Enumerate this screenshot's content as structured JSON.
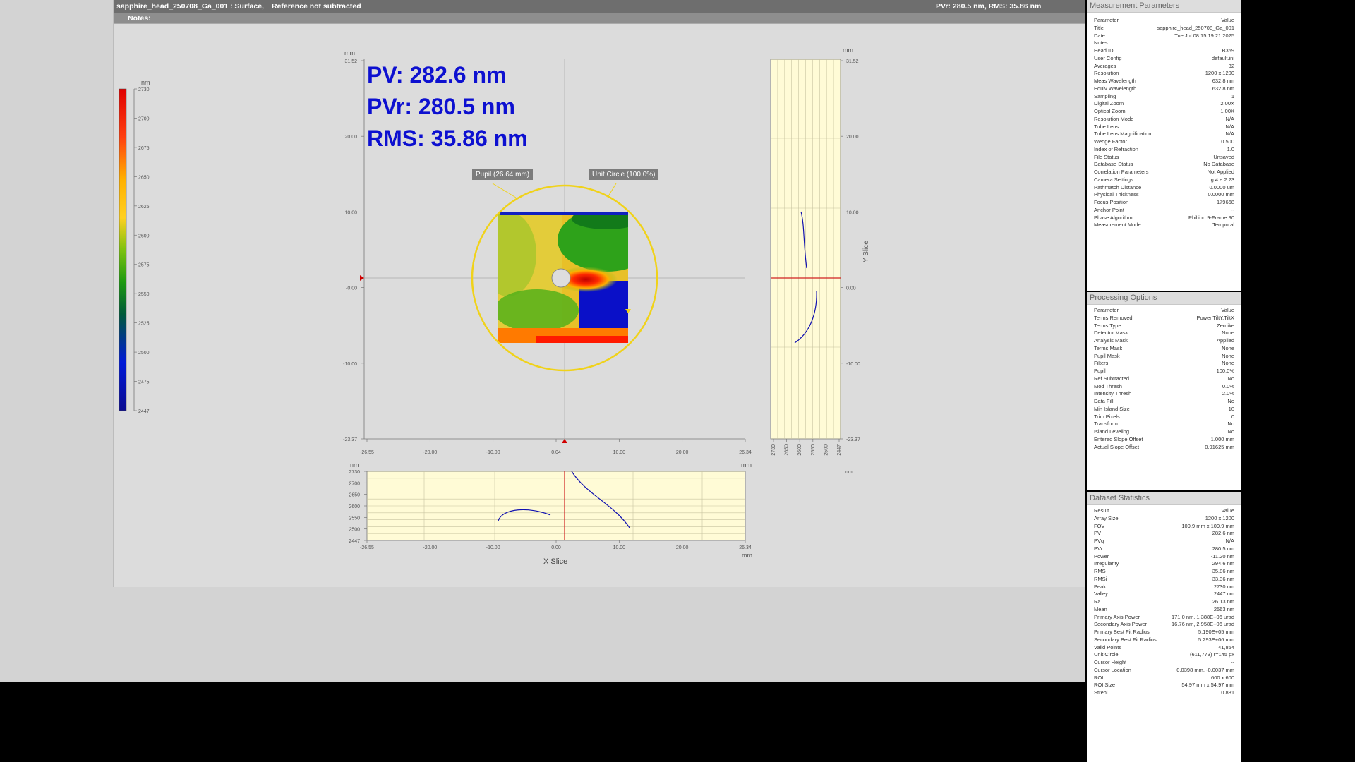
{
  "header": {
    "file": "sapphire_head_250708_Ga_001 : Surface,",
    "reference": "Reference not subtracted",
    "summary": "PVr: 280.5 nm, RMS: 35.86 nm",
    "notes_label": "Notes:"
  },
  "overlay": {
    "pv": "PV: 282.6 nm",
    "pvr": "PVr: 280.5 nm",
    "rms": "RMS: 35.86 nm",
    "pupil_tag": "Pupil (26.64 mm)",
    "unit_circle_tag": "Unit Circle (100.0%)"
  },
  "colorbar": {
    "unit": "nm",
    "ticks": [
      "2730",
      "2700",
      "2675",
      "2650",
      "2625",
      "2600",
      "2575",
      "2550",
      "2525",
      "2500",
      "2475",
      "2447"
    ]
  },
  "main_plot": {
    "unit_y": "mm",
    "unit_x": "mm",
    "y_ticks": [
      "31.52",
      "20.00",
      "10.00",
      "-0.00",
      "-10.00",
      "-23.37"
    ],
    "x_ticks": [
      "-26.55",
      "-20.00",
      "-10.00",
      "0.04",
      "10.00",
      "20.00",
      "26.34"
    ]
  },
  "y_slice": {
    "title": "Y Slice",
    "unit_top": "mm",
    "unit_bottom": "nm",
    "y_ticks": [
      "31.52",
      "20.00",
      "10.00",
      "0.00",
      "-10.00",
      "-23.37"
    ],
    "x_ticks": [
      "2730",
      "2650",
      "2600",
      "2550",
      "2500",
      "2447"
    ]
  },
  "x_slice": {
    "title": "X Slice",
    "unit_y": "nm",
    "unit_x_top": "mm",
    "unit_x_bottom": "mm",
    "y_ticks": [
      "2730",
      "2700",
      "2650",
      "2600",
      "2550",
      "2500",
      "2447"
    ],
    "x_ticks": [
      "-26.55",
      "-20.00",
      "-10.00",
      "0.00",
      "10.00",
      "20.00",
      "26.34"
    ]
  },
  "measurement_parameters": {
    "title": "Measurement Parameters",
    "rows": [
      [
        "Parameter",
        "Value"
      ],
      [
        "Title",
        "sapphire_head_250708_Ga_001"
      ],
      [
        "Date",
        "Tue Jul 08 15:19:21 2025"
      ],
      [
        "Notes",
        ""
      ],
      [
        "Head ID",
        "B359"
      ],
      [
        "User Config",
        "default.ini"
      ],
      [
        "Averages",
        "32"
      ],
      [
        "Resolution",
        "1200 x 1200"
      ],
      [
        "Meas Wavelength",
        "632.8 nm"
      ],
      [
        "Equiv Wavelength",
        "632.8 nm"
      ],
      [
        "Sampling",
        "1"
      ],
      [
        "Digital Zoom",
        "2.00X"
      ],
      [
        "Optical Zoom",
        "1.00X"
      ],
      [
        "Resolution Mode",
        "N/A"
      ],
      [
        "Tube Lens",
        "N/A"
      ],
      [
        "Tube Lens Magnification",
        "N/A"
      ],
      [
        "Wedge Factor",
        "0.500"
      ],
      [
        "Index of Refraction",
        "1.0"
      ],
      [
        "File Status",
        "Unsaved"
      ],
      [
        "Database Status",
        "No Database"
      ],
      [
        "Correlation Parameters",
        "Not Applied"
      ],
      [
        "Camera Settings",
        "g:4 e:2.23"
      ],
      [
        "Pathmatch Distance",
        "0.0000 um"
      ],
      [
        "Physical Thickness",
        "0.0000 mm"
      ],
      [
        "Focus Position",
        "179668"
      ],
      [
        "Anchor Point",
        "--"
      ],
      [
        "Phase Algorithm",
        "Phillion 9-Frame 90"
      ],
      [
        "Measurement Mode",
        "Temporal"
      ]
    ]
  },
  "processing_options": {
    "title": "Processing Options",
    "rows": [
      [
        "Parameter",
        "Value"
      ],
      [
        "Terms Removed",
        "Power,TiltY,TiltX"
      ],
      [
        "Terms Type",
        "Zernike"
      ],
      [
        "Detector Mask",
        "None"
      ],
      [
        "Analysis Mask",
        "Applied"
      ],
      [
        "Terms Mask",
        "None"
      ],
      [
        "Pupil Mask",
        "None"
      ],
      [
        "Filters",
        "None"
      ],
      [
        "Pupil",
        "100.0%"
      ],
      [
        "Ref Subtracted",
        "No"
      ],
      [
        "Mod Thresh",
        "0.0%"
      ],
      [
        "Intensity Thresh",
        "2.0%"
      ],
      [
        "Data Fill",
        "No"
      ],
      [
        "Min Island Size",
        "10"
      ],
      [
        "Trim Pixels",
        "0"
      ],
      [
        "Transform",
        "No"
      ],
      [
        "Island Leveling",
        "No"
      ],
      [
        "Entered Slope Offset",
        "1.000 mm"
      ],
      [
        "Actual Slope Offset",
        "0.91625 mm"
      ]
    ]
  },
  "dataset_statistics": {
    "title": "Dataset Statistics",
    "rows": [
      [
        "Result",
        "Value"
      ],
      [
        "Array Size",
        "1200 x 1200"
      ],
      [
        "FOV",
        "109.9 mm x 109.9 mm"
      ],
      [
        "PV",
        "282.6 nm"
      ],
      [
        "PVq",
        "N/A"
      ],
      [
        "PVr",
        "280.5 nm"
      ],
      [
        "Power",
        "-11.20 nm"
      ],
      [
        "Irregularity",
        "294.6 nm"
      ],
      [
        "RMS",
        "35.86 nm"
      ],
      [
        "RMSi",
        "33.36 nm"
      ],
      [
        "Peak",
        "2730 nm"
      ],
      [
        "Valley",
        "2447 nm"
      ],
      [
        "Ra",
        "26.13 nm"
      ],
      [
        "Mean",
        "2563 nm"
      ],
      [
        "Primary Axis Power",
        "171.0 nm, 1.388E+06 urad"
      ],
      [
        "Secondary Axis Power",
        "16.76 nm, 2.958E+06 urad"
      ],
      [
        "Primary Best Fit Radius",
        "5.190E+05 mm"
      ],
      [
        "Secondary Best Fit Radius",
        "5.293E+06 mm"
      ],
      [
        "Valid Points",
        "41,854"
      ],
      [
        "Unit Circle",
        "(611,773) r=145 px"
      ],
      [
        "Cursor Height",
        "--"
      ],
      [
        "Cursor Location",
        "0.0398 mm, -0.0037 mm"
      ],
      [
        "ROI",
        "600 x 600"
      ],
      [
        "ROI Size",
        "54.97 mm x 54.97 mm"
      ],
      [
        "Strehl",
        "0.881"
      ]
    ]
  }
}
